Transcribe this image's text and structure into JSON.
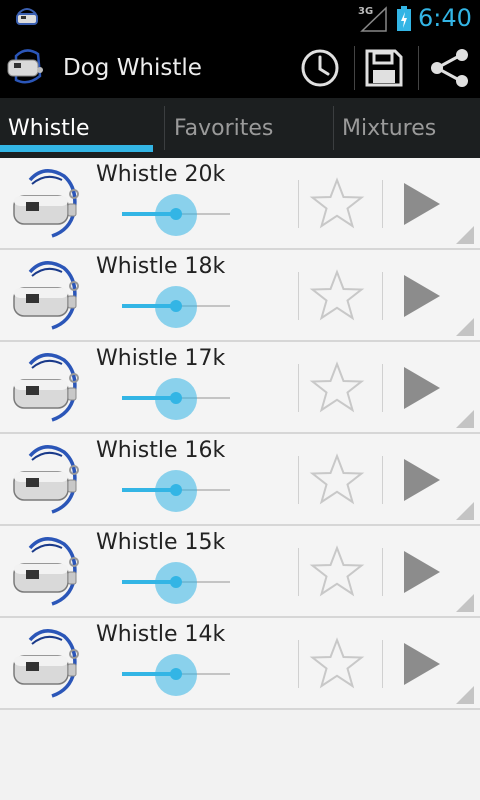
{
  "status_bar": {
    "network": "3G",
    "time": "6:40",
    "icons": [
      "app-notification-icon",
      "signal-icon",
      "battery-charging-icon"
    ]
  },
  "action_bar": {
    "title": "Dog Whistle",
    "icons": [
      "app-logo-icon",
      "history-icon",
      "save-icon",
      "share-icon"
    ]
  },
  "tabs": [
    {
      "label": "Whistle",
      "active": true
    },
    {
      "label": "Favorites",
      "active": false
    },
    {
      "label": "Mixtures",
      "active": false
    }
  ],
  "whistles": [
    {
      "label": "Whistle 20k",
      "volume": 0.5,
      "favorite": false
    },
    {
      "label": "Whistle 18k",
      "volume": 0.5,
      "favorite": false
    },
    {
      "label": "Whistle 17k",
      "volume": 0.5,
      "favorite": false
    },
    {
      "label": "Whistle 16k",
      "volume": 0.5,
      "favorite": false
    },
    {
      "label": "Whistle 15k",
      "volume": 0.5,
      "favorite": false
    },
    {
      "label": "Whistle 14k",
      "volume": 0.5,
      "favorite": false
    }
  ],
  "colors": {
    "accent": "#33b5e5",
    "action_bar_bg": "#000000",
    "tab_bar_bg": "#1c1f20",
    "list_bg": "#f2f2f2"
  }
}
